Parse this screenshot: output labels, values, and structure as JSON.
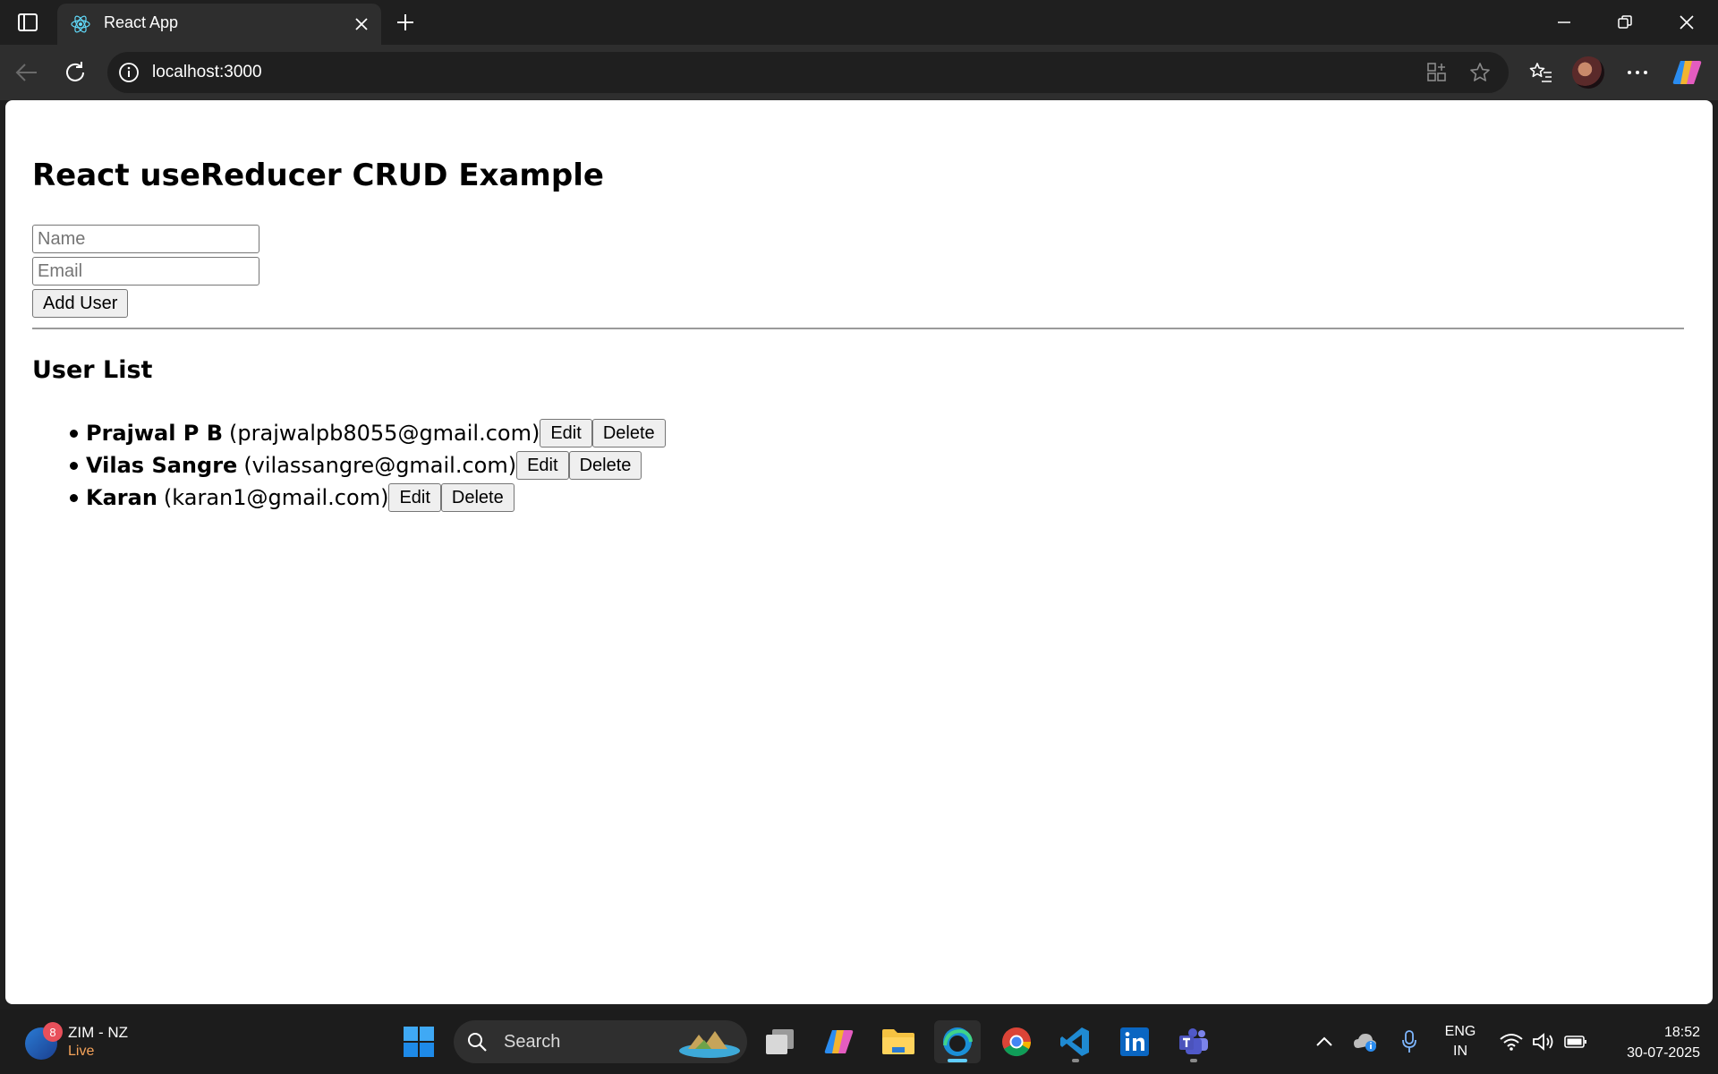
{
  "browser": {
    "tab_title": "React App",
    "url": "localhost:3000"
  },
  "page": {
    "heading": "React useReducer CRUD Example",
    "name_placeholder": "Name",
    "email_placeholder": "Email",
    "add_button": "Add User",
    "list_heading": "User List",
    "edit_label": "Edit",
    "delete_label": "Delete",
    "users": [
      {
        "name": "Prajwal P B",
        "email": "(prajwalpb8055@gmail.com)"
      },
      {
        "name": "Vilas Sangre",
        "email": "(vilassangre@gmail.com)"
      },
      {
        "name": "Karan",
        "email": "(karan1@gmail.com)"
      }
    ]
  },
  "taskbar": {
    "weather_label": "ZIM - NZ",
    "weather_status": "Live",
    "weather_badge": "8",
    "search_label": "Search",
    "lang_line1": "ENG",
    "lang_line2": "IN",
    "time": "18:52",
    "date": "30-07-2025"
  },
  "colors": {
    "chrome_dark": "#1f1f1f",
    "chrome_mid": "#2e2e2e",
    "page_bg": "#ffffff",
    "accent": "#60cdff"
  }
}
